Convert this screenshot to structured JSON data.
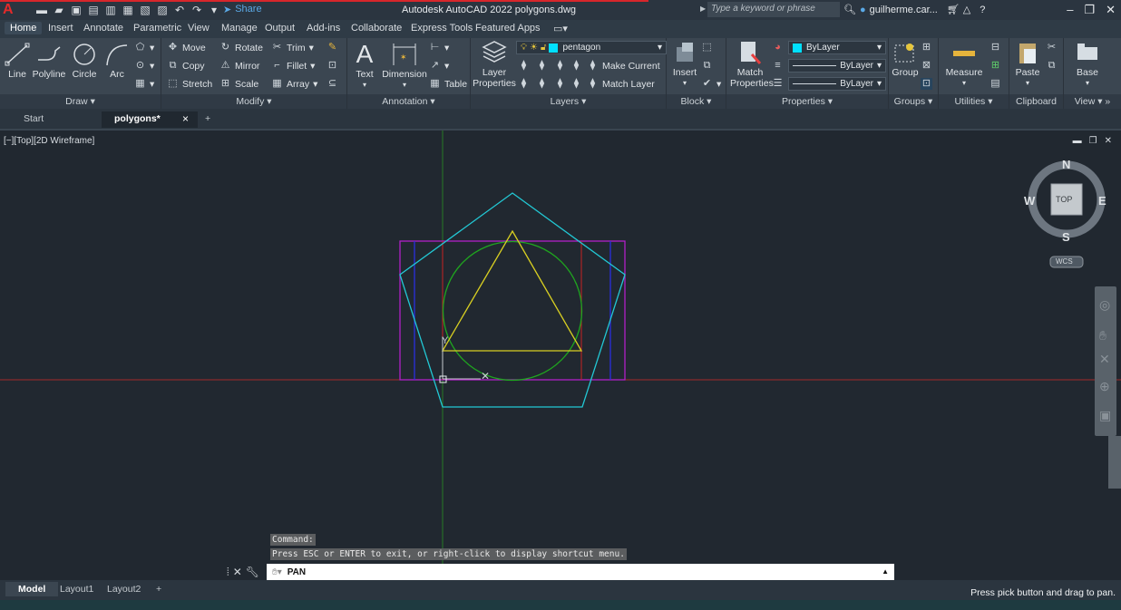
{
  "title_bar": {
    "app_title": "Autodesk AutoCAD 2022   polygons.dwg",
    "share_label": "Share",
    "search_placeholder": "Type a keyword or phrase",
    "user_name": "guilherme.car...",
    "logo": "A"
  },
  "ribbon_tabs": [
    "Home",
    "Insert",
    "Annotate",
    "Parametric",
    "View",
    "Manage",
    "Output",
    "Add-ins",
    "Collaborate",
    "Express Tools",
    "Featured Apps"
  ],
  "panels": {
    "draw": {
      "title": "Draw",
      "line": "Line",
      "polyline": "Polyline",
      "circle": "Circle",
      "arc": "Arc"
    },
    "modify": {
      "title": "Modify",
      "move": "Move",
      "rotate": "Rotate",
      "trim": "Trim",
      "copy": "Copy",
      "mirror": "Mirror",
      "fillet": "Fillet",
      "stretch": "Stretch",
      "scale": "Scale",
      "array": "Array"
    },
    "annotation": {
      "title": "Annotation",
      "text": "Text",
      "dimension": "Dimension",
      "table": "Table"
    },
    "layers": {
      "title": "Layers",
      "layer_properties": "Layer Properties",
      "current_layer": "pentagon",
      "make_current": "Make Current",
      "match_layer": "Match Layer"
    },
    "block": {
      "title": "Block",
      "insert": "Insert"
    },
    "properties": {
      "title": "Properties",
      "match_properties": "Match Properties",
      "color": "ByLayer",
      "linetype": "ByLayer",
      "lineweight": "ByLayer"
    },
    "groups": {
      "title": "Groups",
      "group": "Group"
    },
    "utilities": {
      "title": "Utilities",
      "measure": "Measure"
    },
    "clipboard": {
      "title": "Clipboard",
      "paste": "Paste"
    },
    "view": {
      "title": "View",
      "base": "Base"
    }
  },
  "file_tabs": {
    "start": "Start",
    "drawing": "polygons*",
    "close": "×",
    "new": "+"
  },
  "viewport": {
    "label": "[−][Top][2D Wireframe]"
  },
  "viewcube": {
    "north": "N",
    "south": "S",
    "east": "E",
    "west": "W",
    "face": "TOP",
    "wcs": "WCS"
  },
  "command": {
    "history_1": "Command:",
    "history_2": "Press ESC or ENTER to exit, or right-click to display shortcut menu.",
    "current": "PAN"
  },
  "layout_tabs": [
    "Model",
    "Layout1",
    "Layout2"
  ],
  "status_message": "Press pick button and drag to pan.",
  "colors": {
    "pentagon": "#22c8d4",
    "rectangle": "#b020c8",
    "circle": "#1fa51f",
    "triangle": "#d8cf22",
    "blue_lines": "#2a2fe0",
    "red_lines": "#c82222",
    "axis_red": "#a22a2a",
    "axis_green": "#267a26",
    "layer_swatch": "#00e0ff"
  }
}
